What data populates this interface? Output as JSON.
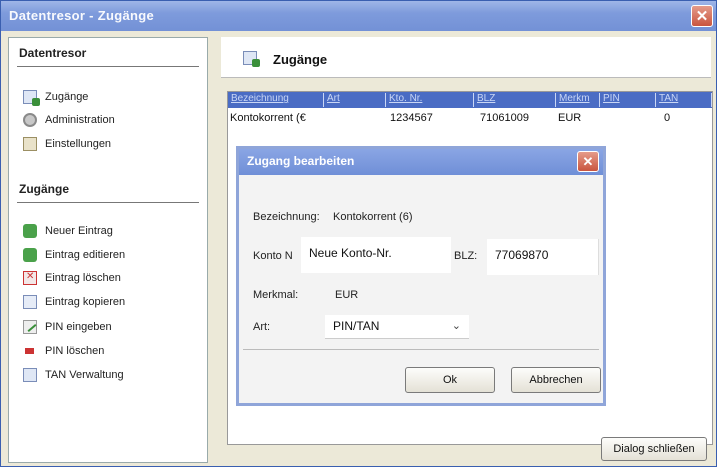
{
  "window": {
    "title": "Datentresor - Zugänge",
    "close_glyph": "✕"
  },
  "left": {
    "section1_title": "Datentresor",
    "section1_items": [
      {
        "label": "Zugänge",
        "icon": "accounts-icon"
      },
      {
        "label": "Administration",
        "icon": "gear-icon"
      },
      {
        "label": "Einstellungen",
        "icon": "settings-icon"
      }
    ],
    "section2_title": "Zugänge",
    "section2_items": [
      {
        "label": "Neuer Eintrag"
      },
      {
        "label": "Eintrag editieren"
      },
      {
        "label": "Eintrag löschen"
      },
      {
        "label": "Eintrag kopieren"
      },
      {
        "label": "PIN eingeben"
      },
      {
        "label": "PIN löschen"
      },
      {
        "label": "TAN Verwaltung"
      }
    ]
  },
  "main": {
    "header": "Zugänge",
    "columns": [
      "Bezeichnung",
      "Art",
      "Kto. Nr.",
      "BLZ",
      "Merkm",
      "PIN",
      "TAN"
    ],
    "rows": [
      {
        "bezeichnung": "Kontokorrent (€",
        "art": "",
        "kto": "1234567",
        "blz": "71061009",
        "merkmal": "EUR",
        "pin": "",
        "tan": "0"
      }
    ],
    "close_dialog_button": "Dialog schließen"
  },
  "dialog": {
    "title": "Zugang bearbeiten",
    "bezeichnung_label": "Bezeichnung:",
    "bezeichnung_value": "Kontokorrent (6)",
    "konto_label": "Konto N",
    "konto_value": "Neue Konto-Nr.",
    "blz_label": "BLZ:",
    "blz_value": "77069870",
    "merkmal_label": "Merkmal:",
    "merkmal_value": "EUR",
    "art_label": "Art:",
    "art_value": "PIN/TAN",
    "ok_label": "Ok",
    "cancel_label": "Abbrechen"
  }
}
